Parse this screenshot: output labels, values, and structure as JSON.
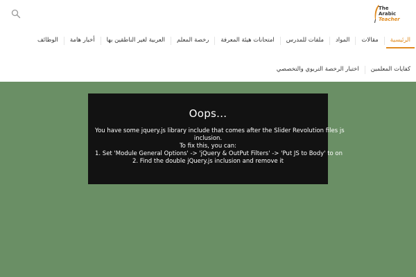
{
  "logo": {
    "line1": "The Arabic",
    "line2": "Teacher"
  },
  "nav": {
    "row1": [
      {
        "label": "الرئيسية",
        "active": true
      },
      {
        "label": "مقالات"
      },
      {
        "label": "المواد"
      },
      {
        "label": "ملفات للمدرس"
      },
      {
        "label": "امتحانات هيئة المعرفة"
      },
      {
        "label": "رخصة المعلم"
      },
      {
        "label": "العربية لغير الناطقين بها"
      },
      {
        "label": "أخبار هامة"
      },
      {
        "label": "الوظائف"
      }
    ],
    "row2": [
      {
        "label": "كفايات المعلمين"
      },
      {
        "label": "اختبار الرخصة التربوي والتخصصي"
      }
    ]
  },
  "error": {
    "title": "Oops...",
    "lines": [
      "You have some jquery.js library include that comes after the Slider Revolution files js",
      "inclusion.",
      "To fix this, you can:",
      "1. Set 'Module General Options' -> 'jQuery & OutPut Filters' -> 'Put JS to Body' to on",
      "2. Find the double jQuery.js inclusion and remove it"
    ]
  },
  "colors": {
    "accent": "#e08a1e",
    "slider_bg": "#6a8f65",
    "error_bg": "#121212"
  }
}
